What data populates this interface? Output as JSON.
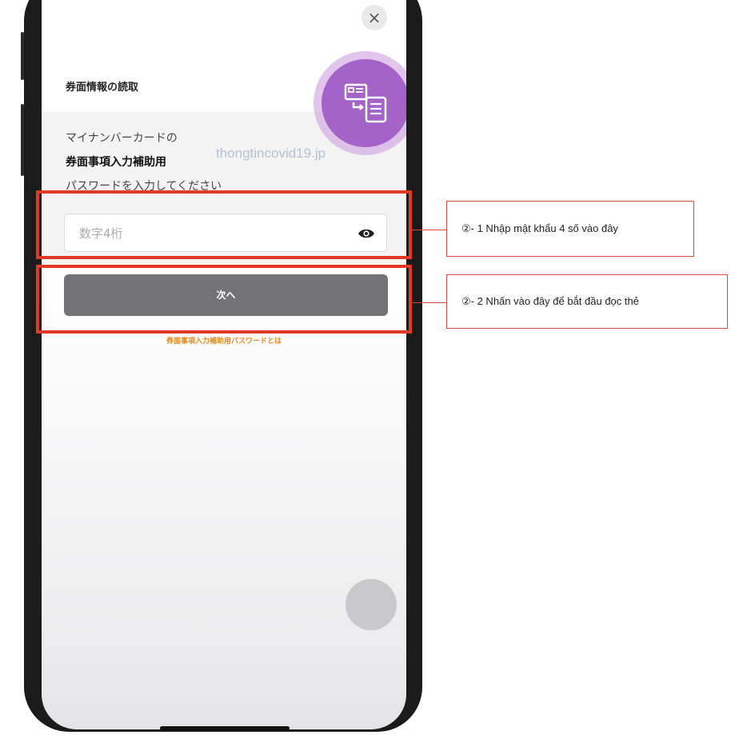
{
  "modal": {
    "close_symbol": "×",
    "title": "券面情報の読取",
    "instruction_line1": "マイナンバーカードの",
    "instruction_line2": "券面事項入力補助用",
    "instruction_line3": "パスワードを入力してください",
    "watermark": "thongtincovid19.jp"
  },
  "password_field": {
    "placeholder": "数字4桁",
    "value": ""
  },
  "next_button": {
    "label": "次へ"
  },
  "help_link": {
    "label": "券面事項入力補助用パスワードとは"
  },
  "annotations": {
    "callout1": "②- 1 Nhập mật khẩu 4 số vào đây",
    "callout2": "②- 2 Nhấn vào đây để bắt đầu đọc thẻ"
  },
  "colors": {
    "accent_purple": "#a463c9",
    "button_gray": "#737377",
    "link_orange": "#e08a1e",
    "highlight_red": "#e03a24"
  },
  "icons": [
    "close-icon",
    "card-read-icon",
    "eye-icon"
  ]
}
